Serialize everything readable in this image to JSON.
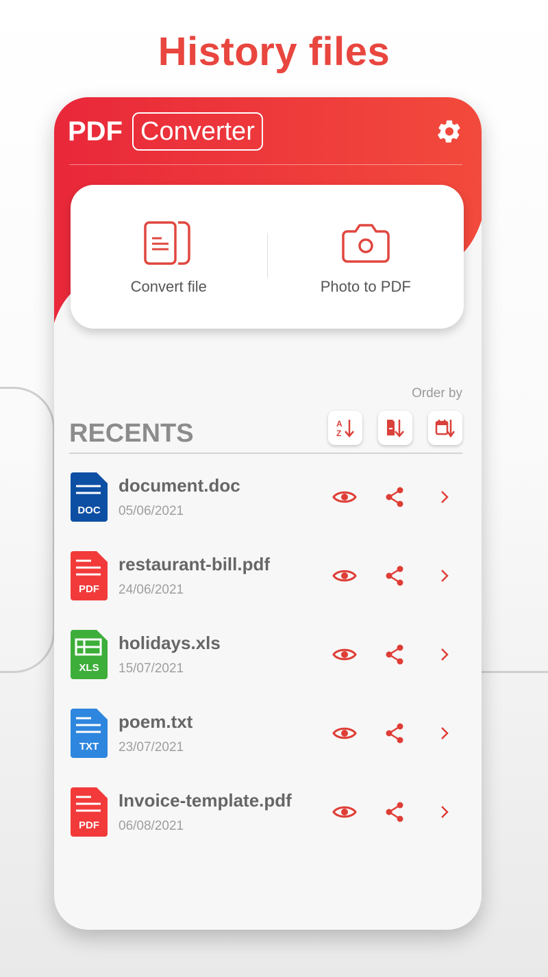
{
  "promo": {
    "title": "History files"
  },
  "header": {
    "brand_pdf": "PDF",
    "brand_converter": "Converter"
  },
  "actions": [
    {
      "label": "Convert file",
      "icon": "document-icon"
    },
    {
      "label": "Photo to PDF",
      "icon": "camera-icon"
    }
  ],
  "recents": {
    "title": "RECENTS",
    "order_by_label": "Order by",
    "sort_options": [
      {
        "icon": "sort-alpha-icon",
        "glyph_top": "A",
        "glyph_bottom": "Z"
      },
      {
        "icon": "sort-type-icon"
      },
      {
        "icon": "sort-date-icon"
      }
    ],
    "files": [
      {
        "name": "document.doc",
        "date": "05/06/2021",
        "type": "DOC",
        "color": "#0d4fa3"
      },
      {
        "name": "restaurant-bill.pdf",
        "date": "24/06/2021",
        "type": "PDF",
        "color": "#f23a3a"
      },
      {
        "name": "holidays.xls",
        "date": "15/07/2021",
        "type": "XLS",
        "color": "#3dae3a"
      },
      {
        "name": "poem.txt",
        "date": "23/07/2021",
        "type": "TXT",
        "color": "#2e86de"
      },
      {
        "name": "Invoice-template.pdf",
        "date": "06/08/2021",
        "type": "PDF",
        "color": "#f23a3a"
      }
    ]
  },
  "colors": {
    "accent": "#e8463f",
    "header_red": "#ee2f35"
  }
}
